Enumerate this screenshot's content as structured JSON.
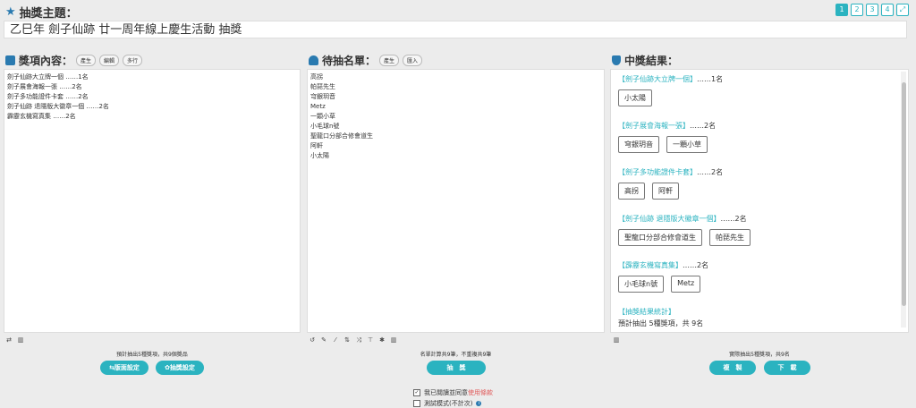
{
  "header": {
    "topic_label": "抽獎主題：",
    "topic_value": "乙巳年 劍子仙跡 廿一周年線上慶生活動 抽獎",
    "pages": [
      "1",
      "2",
      "3",
      "4"
    ]
  },
  "prizes": {
    "title": "獎項內容：",
    "buttons": [
      "產生",
      "編輯",
      "多行"
    ],
    "items": [
      "劍子仙跡大立牌一個 ……1名",
      "劍子展會海報一張 ……2名",
      "劍子多功能證件卡套 ……2名",
      "劍子仙跡 退隱版大徽章一個 ……2名",
      "霹靂玄機寫真集 ……2名"
    ],
    "caption": "預計抽出5種獎項，共9個獎品",
    "btn_layout": "⇆版面設定",
    "btn_settings": "✿抽獎設定"
  },
  "candidates": {
    "title": "待抽名單：",
    "buttons": [
      "產生",
      "匯入"
    ],
    "names": [
      "高拐",
      "帕琵先生",
      "穹銀玥音",
      "Metz",
      "一顆小草",
      "小毛球n號",
      "聖龍口分部合修會道生",
      "阿軒",
      "小太陽"
    ],
    "caption": "名單計算共9筆，不重複共9筆",
    "btn_draw": "抽　獎"
  },
  "results": {
    "title": "中獎結果：",
    "groups": [
      {
        "prize": "【劍子仙跡大立牌一個】",
        "count": "……1名",
        "winners": [
          "小太陽"
        ]
      },
      {
        "prize": "【劍子展會海報一張】",
        "count": "……2名",
        "winners": [
          "穹銀玥音",
          "一顆小草"
        ]
      },
      {
        "prize": "【劍子多功能證件卡套】",
        "count": "……2名",
        "winners": [
          "高拐",
          "阿軒"
        ]
      },
      {
        "prize": "【劍子仙跡 退隱版大徽章一個】",
        "count": "……2名",
        "winners": [
          "聖龍口分部合修會道生",
          "帕琵先生"
        ]
      },
      {
        "prize": "【霹靂玄機寫真集】",
        "count": "……2名",
        "winners": [
          "小毛球n號",
          "Metz"
        ]
      }
    ],
    "stats_title": "【抽獎結果統計】",
    "stats_text": "預計抽出 5種獎項，共 9名",
    "caption": "實際抽出5種獎項，共9名",
    "btn_copy": "複　製",
    "btn_download": "下　載"
  },
  "footer": {
    "agree_prefix": "我已閱讀並同意",
    "agree_link": "使用條款",
    "test_mode": "測試模式(不計次)"
  },
  "colors": {
    "accent": "#2bb3c0",
    "icon": "#2a7ab0",
    "link": "#e05a5a"
  }
}
